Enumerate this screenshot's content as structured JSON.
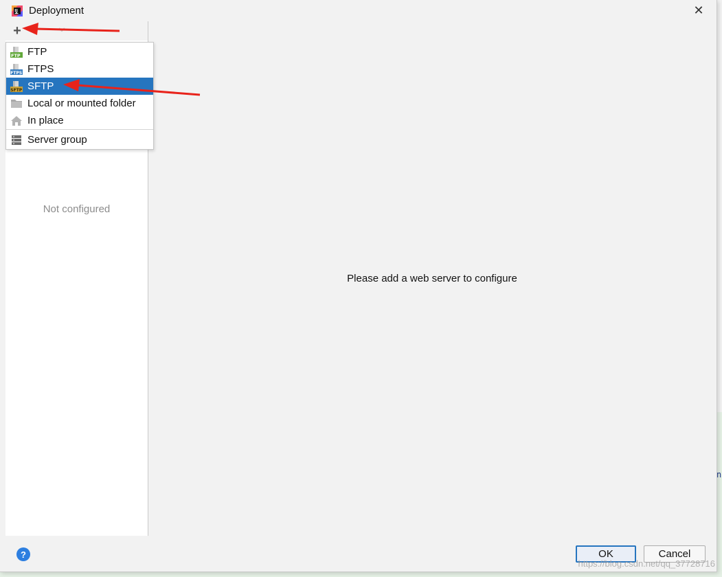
{
  "window": {
    "title": "Deployment",
    "close_glyph": "✕"
  },
  "toolbar": {
    "add_glyph": "+"
  },
  "menu": {
    "items": [
      {
        "label": "FTP",
        "icon": "ftp-icon"
      },
      {
        "label": "FTPS",
        "icon": "ftps-icon"
      },
      {
        "label": "SFTP",
        "icon": "sftp-icon",
        "selected": true
      },
      {
        "label": "Local or mounted folder",
        "icon": "folder-icon"
      },
      {
        "label": "In place",
        "icon": "home-icon"
      },
      {
        "label": "Server group",
        "icon": "server-group-icon"
      }
    ]
  },
  "left_panel": {
    "empty_text": "Not configured"
  },
  "main": {
    "message": "Please add a web server to configure"
  },
  "footer": {
    "help_glyph": "?",
    "ok_label": "OK",
    "cancel_label": "Cancel",
    "watermark": "https://blog.csdn.net/qq_37728716"
  },
  "colors": {
    "selection": "#2675bf",
    "annotation_arrow": "#e8231b",
    "help_blue": "#2d7fe0"
  }
}
